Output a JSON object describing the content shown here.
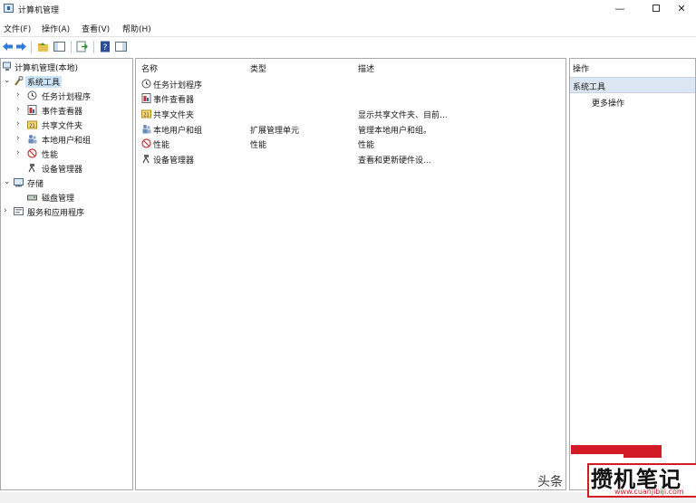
{
  "window": {
    "title": "计算机管理",
    "minimize": "—",
    "close": "✕"
  },
  "menubar": {
    "items": [
      "文件(F)",
      "操作(A)",
      "查看(V)",
      "帮助(H)"
    ]
  },
  "tree": {
    "root": "计算机管理(本地)",
    "system_tools": "系统工具",
    "task_scheduler": "任务计划程序",
    "event_viewer": "事件查看器",
    "shared_folders": "共享文件夹",
    "local_users": "本地用户和组",
    "performance": "性能",
    "device_manager": "设备管理器",
    "storage": "存储",
    "disk_management": "磁盘管理",
    "services_apps": "服务和应用程序"
  },
  "list": {
    "columns": {
      "name": "名称",
      "type": "类型",
      "desc": "描述"
    },
    "rows": [
      {
        "name": "任务计划程序",
        "type": "",
        "desc": ""
      },
      {
        "name": "事件查看器",
        "type": "",
        "desc": ""
      },
      {
        "name": "共享文件夹",
        "type": "",
        "desc": "显示共享文件夹、目前..."
      },
      {
        "name": "本地用户和组",
        "type": "扩展管理单元",
        "desc": "管理本地用户和组。"
      },
      {
        "name": "性能",
        "type": "性能",
        "desc": "性能"
      },
      {
        "name": "设备管理器",
        "type": "",
        "desc": "查看和更新硬件设..."
      }
    ]
  },
  "actions": {
    "header": "操作",
    "section": "系统工具",
    "more": "更多操作"
  },
  "watermark": {
    "source": "头条",
    "brand": "攒机笔记",
    "url": "www.cuanjibiji.com"
  },
  "colors": {
    "selection": "#cce4f7",
    "section_bg": "#dbe6f2",
    "brand_red": "#d21b26"
  }
}
